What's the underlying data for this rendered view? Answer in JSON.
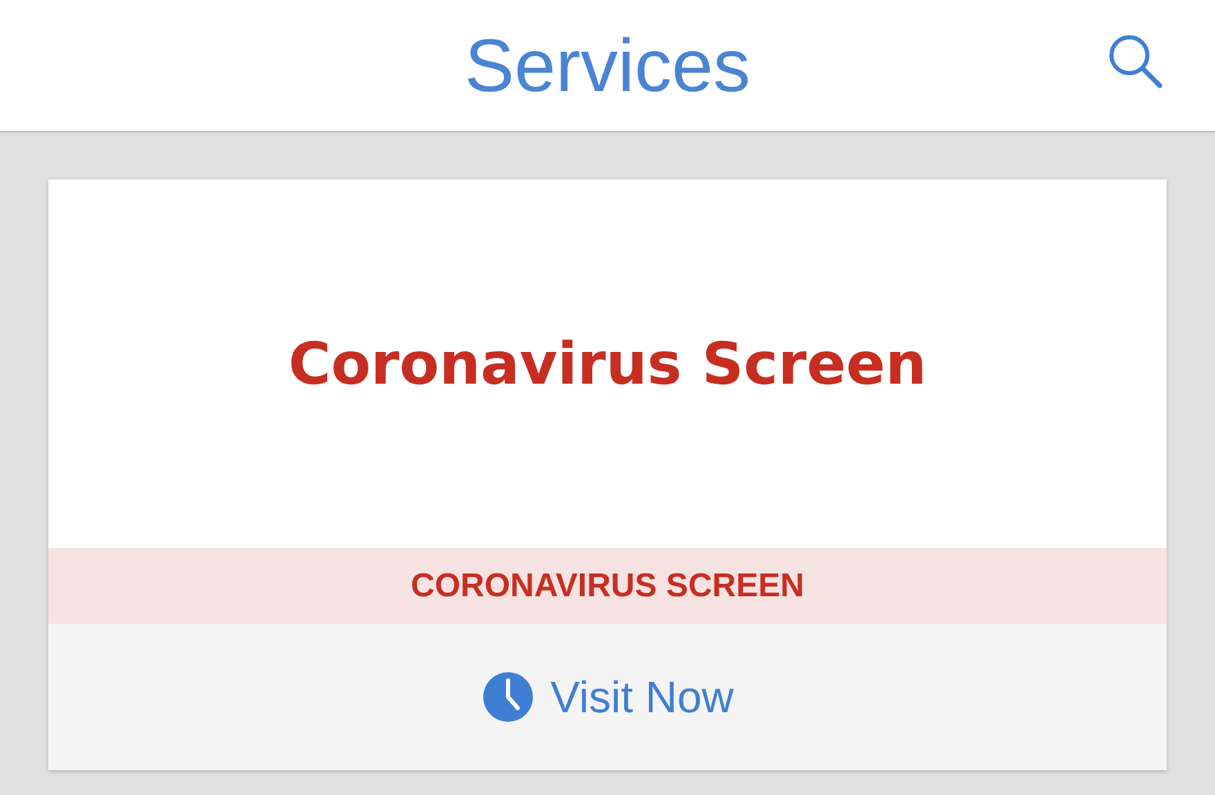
{
  "header": {
    "title": "Services"
  },
  "card": {
    "title": "Coronavirus Screen",
    "band": "CORONAVIRUS SCREEN",
    "action": "Visit Now"
  }
}
